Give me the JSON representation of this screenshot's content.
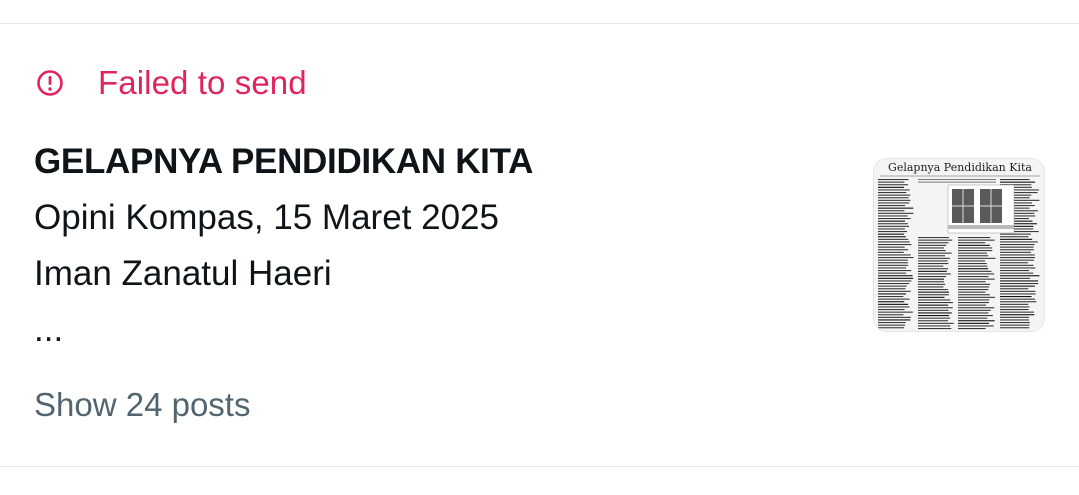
{
  "status": {
    "icon": "alert-circle-icon",
    "text": "Failed to send",
    "color": "#e0245e"
  },
  "post": {
    "title": "GELAPNYA PENDIDIKAN KITA",
    "line1": "Opini Kompas, 15 Maret 2025",
    "line2": "Iman Zanatul Haeri",
    "line3": "..."
  },
  "thumbnail": {
    "headline": "Gelapnya Pendidikan Kita"
  },
  "actions": {
    "show_posts_label": "Show 24 posts"
  }
}
